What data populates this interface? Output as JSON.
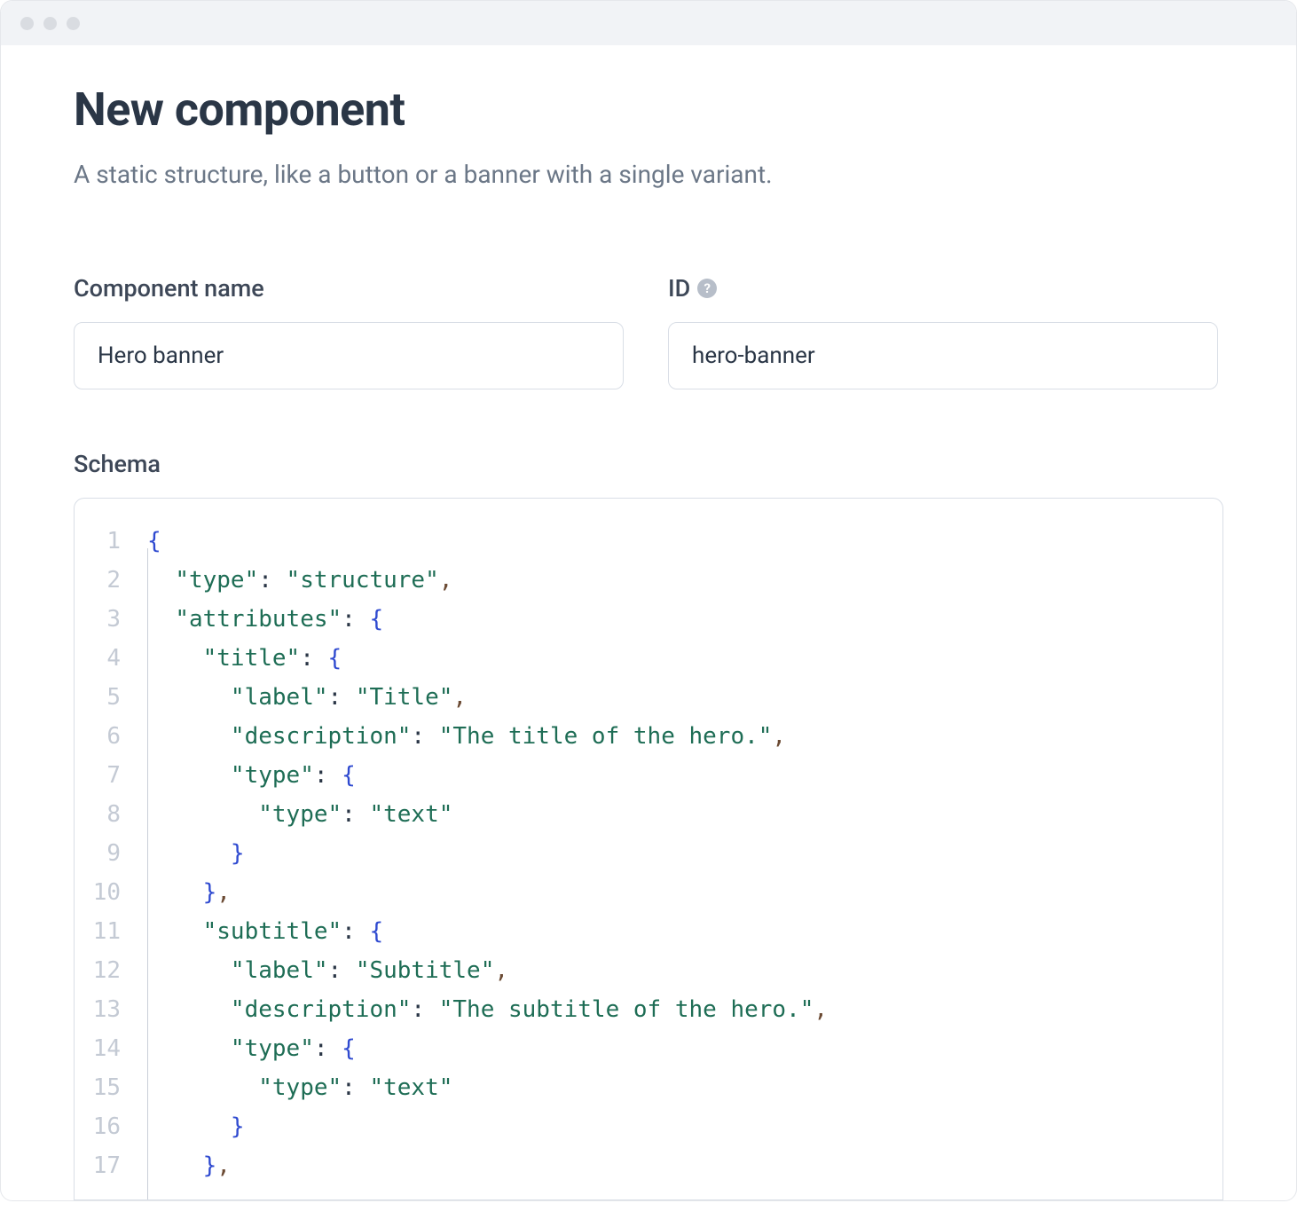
{
  "header": {
    "title": "New component",
    "subtitle": "A static structure, like a button or a banner with a single variant."
  },
  "form": {
    "name_label": "Component name",
    "name_value": "Hero banner",
    "id_label": "ID",
    "id_value": "hero-banner",
    "id_help": "?"
  },
  "schema": {
    "label": "Schema",
    "lines": [
      {
        "n": "1",
        "indent": 0,
        "tokens": [
          [
            "brace",
            "{"
          ]
        ]
      },
      {
        "n": "2",
        "indent": 1,
        "tokens": [
          [
            "string",
            "\"type\""
          ],
          [
            "colon",
            ": "
          ],
          [
            "string",
            "\"structure\""
          ],
          [
            "comma",
            ","
          ]
        ]
      },
      {
        "n": "3",
        "indent": 1,
        "tokens": [
          [
            "string",
            "\"attributes\""
          ],
          [
            "colon",
            ": "
          ],
          [
            "brace",
            "{"
          ]
        ]
      },
      {
        "n": "4",
        "indent": 2,
        "tokens": [
          [
            "string",
            "\"title\""
          ],
          [
            "colon",
            ": "
          ],
          [
            "brace",
            "{"
          ]
        ]
      },
      {
        "n": "5",
        "indent": 3,
        "tokens": [
          [
            "string",
            "\"label\""
          ],
          [
            "colon",
            ": "
          ],
          [
            "string",
            "\"Title\""
          ],
          [
            "comma",
            ","
          ]
        ]
      },
      {
        "n": "6",
        "indent": 3,
        "tokens": [
          [
            "string",
            "\"description\""
          ],
          [
            "colon",
            ": "
          ],
          [
            "string",
            "\"The title of the hero.\""
          ],
          [
            "comma",
            ","
          ]
        ]
      },
      {
        "n": "7",
        "indent": 3,
        "tokens": [
          [
            "string",
            "\"type\""
          ],
          [
            "colon",
            ": "
          ],
          [
            "brace",
            "{"
          ]
        ]
      },
      {
        "n": "8",
        "indent": 4,
        "tokens": [
          [
            "string",
            "\"type\""
          ],
          [
            "colon",
            ": "
          ],
          [
            "string",
            "\"text\""
          ]
        ]
      },
      {
        "n": "9",
        "indent": 3,
        "tokens": [
          [
            "brace",
            "}"
          ]
        ]
      },
      {
        "n": "10",
        "indent": 2,
        "tokens": [
          [
            "brace",
            "}"
          ],
          [
            "comma",
            ","
          ]
        ]
      },
      {
        "n": "11",
        "indent": 2,
        "tokens": [
          [
            "string",
            "\"subtitle\""
          ],
          [
            "colon",
            ": "
          ],
          [
            "brace",
            "{"
          ]
        ]
      },
      {
        "n": "12",
        "indent": 3,
        "tokens": [
          [
            "string",
            "\"label\""
          ],
          [
            "colon",
            ": "
          ],
          [
            "string",
            "\"Subtitle\""
          ],
          [
            "comma",
            ","
          ]
        ]
      },
      {
        "n": "13",
        "indent": 3,
        "tokens": [
          [
            "string",
            "\"description\""
          ],
          [
            "colon",
            ": "
          ],
          [
            "string",
            "\"The subtitle of the hero.\""
          ],
          [
            "comma",
            ","
          ]
        ]
      },
      {
        "n": "14",
        "indent": 3,
        "tokens": [
          [
            "string",
            "\"type\""
          ],
          [
            "colon",
            ": "
          ],
          [
            "brace",
            "{"
          ]
        ]
      },
      {
        "n": "15",
        "indent": 4,
        "tokens": [
          [
            "string",
            "\"type\""
          ],
          [
            "colon",
            ": "
          ],
          [
            "string",
            "\"text\""
          ]
        ]
      },
      {
        "n": "16",
        "indent": 3,
        "tokens": [
          [
            "brace",
            "}"
          ]
        ]
      },
      {
        "n": "17",
        "indent": 2,
        "tokens": [
          [
            "brace",
            "}"
          ],
          [
            "comma",
            ","
          ]
        ]
      }
    ]
  }
}
